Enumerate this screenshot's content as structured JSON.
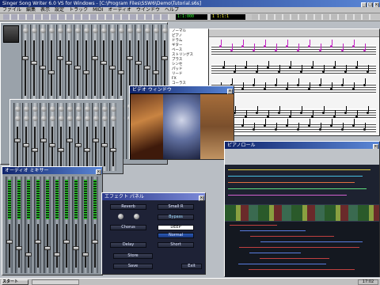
{
  "app": {
    "title": "Singer Song Writer 6.0 VS for Windows - [C:\\Program Files\\SSW6\\Demo\\Tutorial.s6s]",
    "window_controls": [
      "_",
      "□",
      "×"
    ]
  },
  "menu": [
    "ファイル",
    "編集",
    "表示",
    "設定",
    "トラック",
    "MIDI",
    "オーディオ",
    "ウインドウ",
    "ヘルプ"
  ],
  "transport": {
    "time": "1:1:000",
    "counter": "1  1:1:1"
  },
  "video": {
    "title": "ビデオ ウィンドウ"
  },
  "track_list": {
    "items": [
      "ノーマル",
      "ピアノ",
      "ドラム",
      "ギター",
      "ベース",
      "ストリングス",
      "ブラス",
      "シンセ",
      "パッド",
      "リード",
      "FX",
      "コーラス",
      "オルガン",
      "マリンバ",
      "ハープ",
      "シタール",
      "エフェクト"
    ]
  },
  "mixer": {
    "title": "オーディオ ミキサー"
  },
  "fx": {
    "title": "エフェクト パネル",
    "rows": [
      {
        "left": "Reverb",
        "right": "Small R"
      },
      {
        "left": "Chorus",
        "right": "DEEP"
      },
      {
        "left": "Delay",
        "right": "Short"
      }
    ],
    "buttons": [
      "Bypass",
      "Normal",
      "Store",
      "Save",
      "Exit"
    ],
    "selected": "Normal"
  },
  "piano_roll": {
    "title": "ピアノロール"
  },
  "taskbar": {
    "start": "スタート",
    "clock": "17:02"
  }
}
